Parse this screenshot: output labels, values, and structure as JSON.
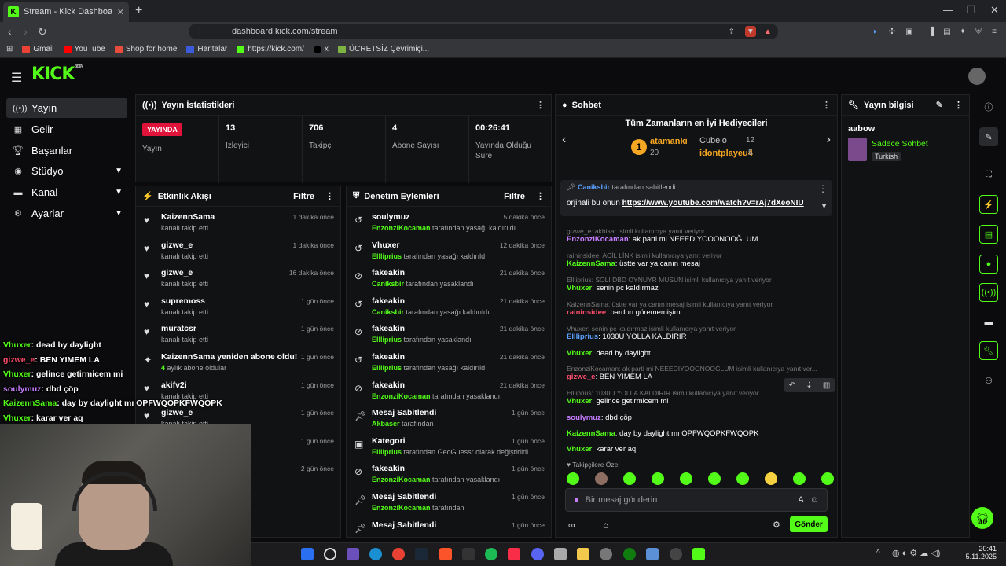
{
  "browser": {
    "tab_title": "Stream - Kick Dashboard",
    "url": "dashboard.kick.com/stream",
    "bookmarks": [
      "Gmail",
      "YouTube",
      "Shop for home",
      "Haritalar",
      "https://kick.com/",
      "x",
      "ÜCRETSİZ Çevrimiçi..."
    ]
  },
  "logo": "KICK",
  "logo_sup": "BETA",
  "sidebar": [
    {
      "label": "Yayın",
      "icon": "broadcast-icon"
    },
    {
      "label": "Gelir",
      "icon": "revenue-icon"
    },
    {
      "label": "Başarılar",
      "icon": "trophy-icon"
    },
    {
      "label": "Stüdyo",
      "icon": "studio-icon"
    },
    {
      "label": "Kanal",
      "icon": "channel-icon"
    },
    {
      "label": "Ayarlar",
      "icon": "settings-icon"
    }
  ],
  "stats": {
    "title": "Yayın İstatistikleri",
    "live": "YAYINDA",
    "live_label": "Yayın",
    "cells": [
      {
        "value": "13",
        "label": "İzleyici"
      },
      {
        "value": "706",
        "label": "Takipçi"
      },
      {
        "value": "4",
        "label": "Abone Sayısı"
      },
      {
        "value": "00:26:41",
        "label": "Yayında Olduğu Süre"
      }
    ]
  },
  "activity": {
    "title": "Etkinlik Akışı",
    "filter": "Filtre",
    "items": [
      {
        "name": "KaizennSama",
        "sub": "kanalı takip etti",
        "time": "1 dakika önce"
      },
      {
        "name": "gizwe_e",
        "sub": "kanalı takip etti",
        "time": "1 dakika önce"
      },
      {
        "name": "gizwe_e",
        "sub": "kanalı takip etti",
        "time": "16 dakika önce"
      },
      {
        "name": "supremoss",
        "sub": "kanalı takip etti",
        "time": "1 gün önce"
      },
      {
        "name": "muratcsr",
        "sub": "kanalı takip etti",
        "time": "1 gün önce"
      },
      {
        "name": "KaizennSama yeniden abone oldu!",
        "sub_prefix": "4",
        "sub": "aylık abone oldular",
        "time": "1 gün önce"
      },
      {
        "name": "akifv2i",
        "sub": "kanalı takip etti",
        "time": "1 gün önce"
      },
      {
        "name": "gizwe_e",
        "sub": "kanalı takip etti",
        "time": "1 gün önce"
      },
      {
        "name": "",
        "sub": "",
        "time": "1 gün önce"
      },
      {
        "name": "",
        "sub": "",
        "time": "2 gün önce"
      }
    ]
  },
  "modlog": {
    "title": "Denetim Eylemleri",
    "filter": "Filtre",
    "items": [
      {
        "name": "soulymuz",
        "actor": "EnzonziKocaman",
        "sub": "tarafından yasağı kaldırıldı",
        "time": "5 dakika önce"
      },
      {
        "name": "Vhuxer",
        "actor": "Ellliprius",
        "sub": "tarafından yasağı kaldırıldı",
        "time": "12 dakika önce"
      },
      {
        "name": "fakeakin",
        "actor": "Caniksbir",
        "sub": "tarafından yasaklandı",
        "time": "21 dakika önce"
      },
      {
        "name": "fakeakin",
        "actor": "Caniksbir",
        "sub": "tarafından yasağı kaldırıldı",
        "time": "21 dakika önce"
      },
      {
        "name": "fakeakin",
        "actor": "Ellliprius",
        "sub": "tarafından yasaklandı",
        "time": "21 dakika önce"
      },
      {
        "name": "fakeakin",
        "actor": "Ellliprius",
        "sub": "tarafından yasağı kaldırıldı",
        "time": "21 dakika önce"
      },
      {
        "name": "fakeakin",
        "actor": "EnzonziKocaman",
        "sub": "tarafından yasaklandı",
        "time": "21 dakika önce"
      },
      {
        "name": "Mesaj Sabitlendi",
        "actor": "Akbaser",
        "sub": "tarafından",
        "time": "1 gün önce"
      },
      {
        "name": "Kategori",
        "actor": "Ellliprius",
        "sub": "tarafından GeoGuessr olarak değiştirildi",
        "time": "1 gün önce"
      },
      {
        "name": "fakeakin",
        "actor": "EnzonziKocaman",
        "sub": "tarafından yasaklandı",
        "time": "1 gün önce"
      },
      {
        "name": "Mesaj Sabitlendi",
        "actor": "EnzonziKocaman",
        "sub": "tarafından",
        "time": "1 gün önce"
      },
      {
        "name": "Mesaj Sabitlendi",
        "actor": "",
        "sub": "",
        "time": "1 gün önce"
      }
    ]
  },
  "chat": {
    "title": "Sohbet",
    "gifters_title": "Tüm Zamanların en İyi Hediyecileri",
    "top_gifter": {
      "name": "atamanki",
      "count": "20"
    },
    "gifter2": {
      "name": "Cubeio",
      "count": "12"
    },
    "gifter3": {
      "name": "idontplayeu4",
      "count": "5"
    },
    "pinned_by": "Caniksbir",
    "pinned_suffix": "tarafından sabitlendi",
    "pinned_text": "orjinali bu onun",
    "pinned_link": "https://www.youtube.com/watch?v=rAj7dXeoNIU",
    "messages": [
      {
        "reply": "gizwe_e: akhisar isimli kullanıcıya yanıt veriyor",
        "user": "EnzonziKocaman",
        "text": ": ak parti mi NEEEDİYOOONOOĞLUM"
      },
      {
        "reply": "raininsidee: ACİL LİNK isimli kullanıcıya yanıt veriyor",
        "user": "KaizennSama",
        "text": ": üstte var ya canın mesaj"
      },
      {
        "reply": "Ellliprius: SOLİ DBD OYNUYR MUSUN isimli kullanıcıya yanıt veriyor",
        "user": "Vhuxer",
        "text": ": senin pc kaldırmaz"
      },
      {
        "reply": "KaizennSama: üstte var ya canın mesaj isimli kullanıcıya yanıt veriyor",
        "user": "raininsidee",
        "text": ": pardon görememişim"
      },
      {
        "reply": "Vhuxer: senin pc kaldırmaz isimli kullanıcıya yanıt veriyor",
        "user": "Ellliprius",
        "text": ": 1030U YOLLA KALDIRIR"
      },
      {
        "reply": "",
        "user": "Vhuxer",
        "text": ": dead by daylight"
      },
      {
        "reply": "EnzonziKocaman: ak parti mi NEEEDİYOOONOOĞLUM isimli kullanıcıya yanıt ver...",
        "user": "gizwe_e",
        "text": ": BEN YIMEM LA"
      },
      {
        "reply": "Ellliprius: 1030U YOLLA KALDIRIR isimli kullanıcıya yanıt veriyor",
        "user": "Vhuxer",
        "text": ": gelince getirmicem mi"
      },
      {
        "reply": "",
        "user": "soulymuz",
        "text": ": dbd çöp"
      },
      {
        "reply": "",
        "user": "KaizennSama",
        "text": ": day by daylight mı OPFWQOPKFWQOPK"
      },
      {
        "reply": "",
        "user": "Vhuxer",
        "text": ": karar ver aq"
      }
    ],
    "followers_only": "Takipçilere Özel",
    "input_placeholder": "Bir mesaj gönderin",
    "send": "Gönder"
  },
  "info": {
    "title": "Yayın bilgisi",
    "channel": "aabow",
    "stream_title": "Sadece Sohbet",
    "language": "Turkish"
  },
  "overlay": [
    {
      "user": "Vhuxer",
      "text": ": dead by daylight"
    },
    {
      "user": "gizwe_e",
      "text": ": BEN YIMEM LA"
    },
    {
      "user": "Vhuxer",
      "text": ": gelince getirmicem mi"
    },
    {
      "user": "soulymuz",
      "text": ": dbd çöp"
    },
    {
      "user": "KaizennSama",
      "text": ": day by daylight mı OPFWQOPKFWQOPK"
    },
    {
      "user": "Vhuxer",
      "text": ": karar ver aq"
    }
  ],
  "taskbar": {
    "time": "20:41",
    "date": "5.11.2025"
  },
  "colors": {
    "accent": "#53fc18",
    "live": "#e0133a"
  }
}
